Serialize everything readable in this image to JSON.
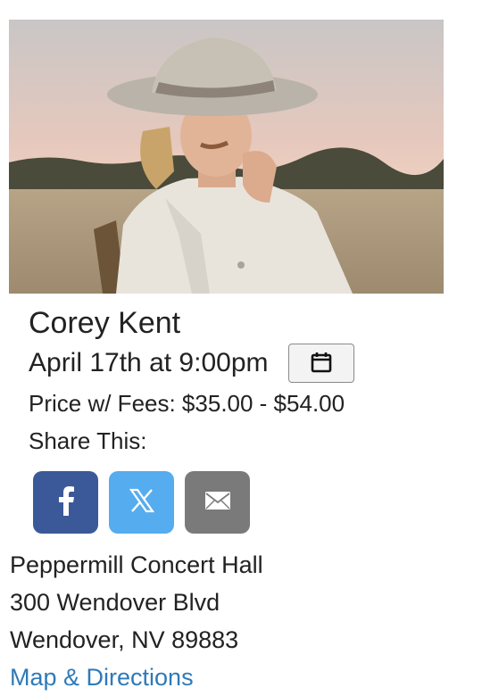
{
  "event": {
    "title": "Corey Kent",
    "date_time": "April 17th at 9:00pm",
    "price": "Price w/ Fees: $35.00 - $54.00",
    "share_label": "Share This:"
  },
  "share_buttons": [
    {
      "network": "facebook",
      "icon": "facebook-icon",
      "color": "#3b5998"
    },
    {
      "network": "x",
      "icon": "x-icon",
      "color": "#55acee"
    },
    {
      "network": "email",
      "icon": "email-icon",
      "color": "#7a7a7a"
    }
  ],
  "calendar_button": {
    "icon": "calendar-icon"
  },
  "venue": {
    "name": "Peppermill Concert Hall",
    "address_line1": "300 Wendover Blvd",
    "address_line2": "Wendover, NV 89883",
    "map_link": "Map & Directions"
  },
  "colors": {
    "link": "#2e7ab8",
    "text": "#222222"
  }
}
